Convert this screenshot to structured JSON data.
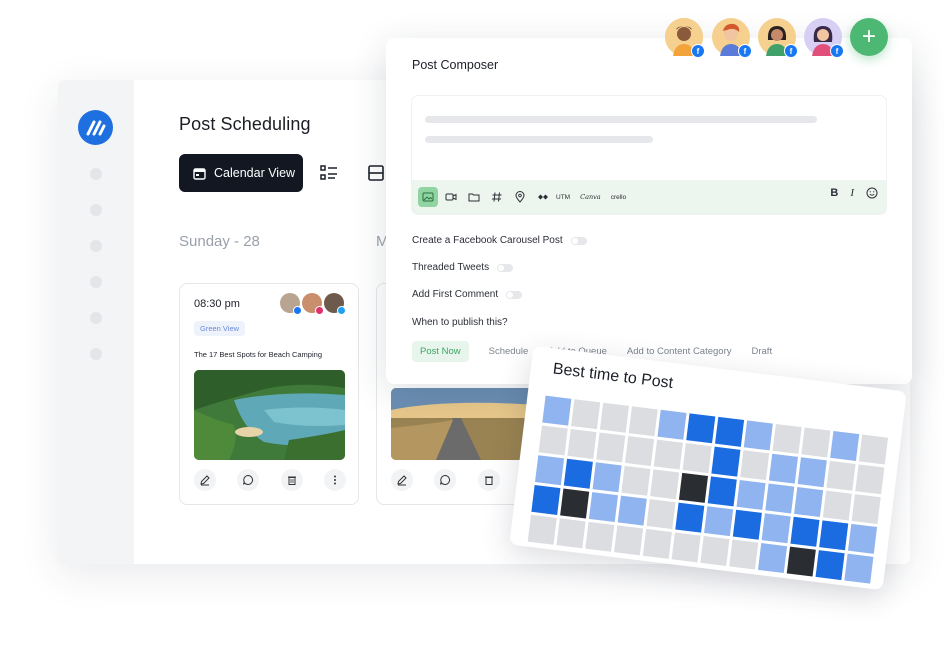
{
  "app": {
    "page_title": "Post Scheduling",
    "calendar_view_label": "Calendar View",
    "days": [
      "Sunday - 28",
      "M"
    ]
  },
  "posts": [
    {
      "time": "08:30 pm",
      "tag": "Green View",
      "title": "The 17 Best Spots for Beach Camping"
    }
  ],
  "composer": {
    "title": "Post Composer",
    "toolbar_words": {
      "utm": "UTM",
      "canva": "Canva",
      "crello": "crello"
    },
    "format": {
      "bold": "B",
      "italic": "I"
    },
    "options": [
      {
        "label": "Create a Facebook Carousel Post",
        "on": false
      },
      {
        "label": "Threaded Tweets",
        "on": false
      },
      {
        "label": "Add First Comment",
        "on": false
      }
    ],
    "when_label": "When to publish this?",
    "publish_tabs": [
      "Post Now",
      "Schedule",
      "Add to Queue",
      "Add to Content Category",
      "Draft"
    ],
    "selected_tab": "Post Now"
  },
  "best_time": {
    "title": "Best time to Post",
    "colors": {
      "light": "#8fb4ef",
      "blue": "#1a6ce0",
      "gray": "#dcdde0",
      "dark": "#2a2e33"
    },
    "grid": [
      [
        "light",
        "gray",
        "gray",
        "gray",
        "light",
        "blue",
        "blue",
        "light",
        "gray",
        "gray",
        "light",
        "gray"
      ],
      [
        "gray",
        "gray",
        "gray",
        "gray",
        "gray",
        "gray",
        "blue",
        "gray",
        "light",
        "light",
        "gray",
        "gray"
      ],
      [
        "light",
        "blue",
        "light",
        "gray",
        "gray",
        "dark",
        "blue",
        "light",
        "light",
        "light",
        "gray",
        "gray"
      ],
      [
        "blue",
        "dark",
        "light",
        "light",
        "gray",
        "blue",
        "light",
        "blue",
        "light",
        "blue",
        "blue",
        "light"
      ],
      [
        "gray",
        "gray",
        "gray",
        "gray",
        "gray",
        "gray",
        "gray",
        "gray",
        "light",
        "dark",
        "blue",
        "light"
      ]
    ]
  },
  "colors": {
    "accent_green": "#4cb874",
    "brand_blue": "#1e6fe0",
    "dark_button": "#121722"
  }
}
